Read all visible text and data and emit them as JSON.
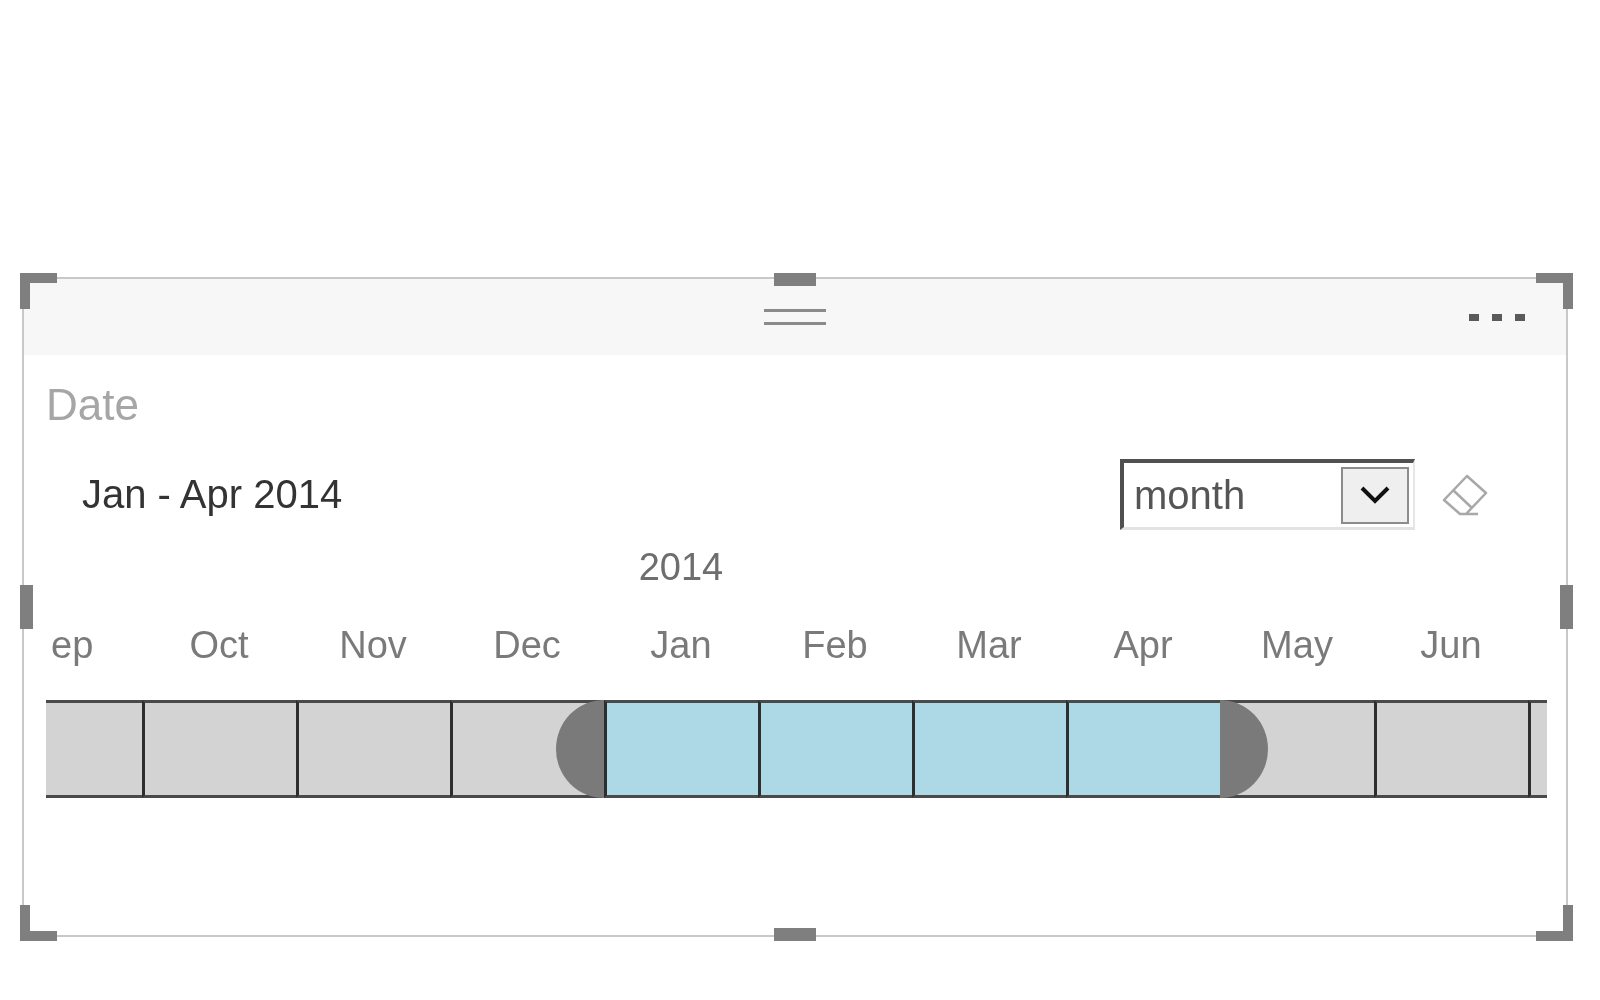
{
  "slicer": {
    "title": "Date",
    "range_label": "Jan - Apr 2014",
    "granularity": "month",
    "months": [
      {
        "label": "ep",
        "selected": false
      },
      {
        "label": "Oct",
        "selected": false
      },
      {
        "label": "Nov",
        "selected": false
      },
      {
        "label": "Dec",
        "selected": false
      },
      {
        "label": "Jan",
        "year": "2014",
        "selected": true
      },
      {
        "label": "Feb",
        "selected": true
      },
      {
        "label": "Mar",
        "selected": true
      },
      {
        "label": "Apr",
        "selected": true
      },
      {
        "label": "May",
        "selected": false
      },
      {
        "label": "Jun",
        "selected": false
      },
      {
        "selected": false
      }
    ]
  }
}
